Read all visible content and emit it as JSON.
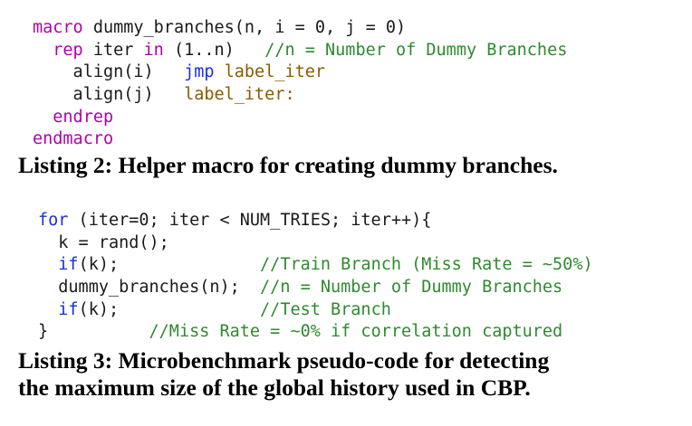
{
  "listing2": {
    "lines": [
      [
        {
          "t": "macro",
          "c": "kw-macro"
        },
        {
          "t": " dummy_branches(n, i = 0, j = 0)",
          "c": ""
        }
      ],
      [
        {
          "t": "  ",
          "c": ""
        },
        {
          "t": "rep",
          "c": "kw-macro"
        },
        {
          "t": " iter ",
          "c": ""
        },
        {
          "t": "in",
          "c": "kw-macro"
        },
        {
          "t": " (1..n)   ",
          "c": ""
        },
        {
          "t": "//n = Number of Dummy Branches",
          "c": "comment"
        }
      ],
      [
        {
          "t": "    align(i)   ",
          "c": ""
        },
        {
          "t": "jmp",
          "c": "kw-blue"
        },
        {
          "t": " ",
          "c": ""
        },
        {
          "t": "label_iter",
          "c": "label"
        }
      ],
      [
        {
          "t": "    align(j)   ",
          "c": ""
        },
        {
          "t": "label_iter:",
          "c": "label"
        }
      ],
      [
        {
          "t": "  ",
          "c": ""
        },
        {
          "t": "endrep",
          "c": "kw-macro"
        }
      ],
      [
        {
          "t": "endmacro",
          "c": "kw-macro"
        }
      ]
    ],
    "caption": "Listing 2: Helper macro for creating dummy branches."
  },
  "listing3": {
    "lines": [
      [
        {
          "t": "for",
          "c": "kw-blue"
        },
        {
          "t": " (iter=0; iter < NUM_TRIES; iter++){",
          "c": ""
        }
      ],
      [
        {
          "t": "  k = rand();",
          "c": ""
        }
      ],
      [
        {
          "t": "  ",
          "c": ""
        },
        {
          "t": "if",
          "c": "kw-blue"
        },
        {
          "t": "(k);              ",
          "c": ""
        },
        {
          "t": "//Train Branch (Miss Rate = ~50%)",
          "c": "comment"
        }
      ],
      [
        {
          "t": "  dummy_branches(n);  ",
          "c": ""
        },
        {
          "t": "//n = Number of Dummy Branches",
          "c": "comment"
        }
      ],
      [
        {
          "t": "  ",
          "c": ""
        },
        {
          "t": "if",
          "c": "kw-blue"
        },
        {
          "t": "(k);              ",
          "c": ""
        },
        {
          "t": "//Test Branch",
          "c": "comment"
        }
      ],
      [
        {
          "t": "}          ",
          "c": ""
        },
        {
          "t": "//Miss Rate = ~0% if correlation captured",
          "c": "comment"
        }
      ]
    ],
    "caption_line1": "Listing 3: Microbenchmark pseudo-code for detecting",
    "caption_line2": "the maximum size of the global history used in CBP."
  }
}
